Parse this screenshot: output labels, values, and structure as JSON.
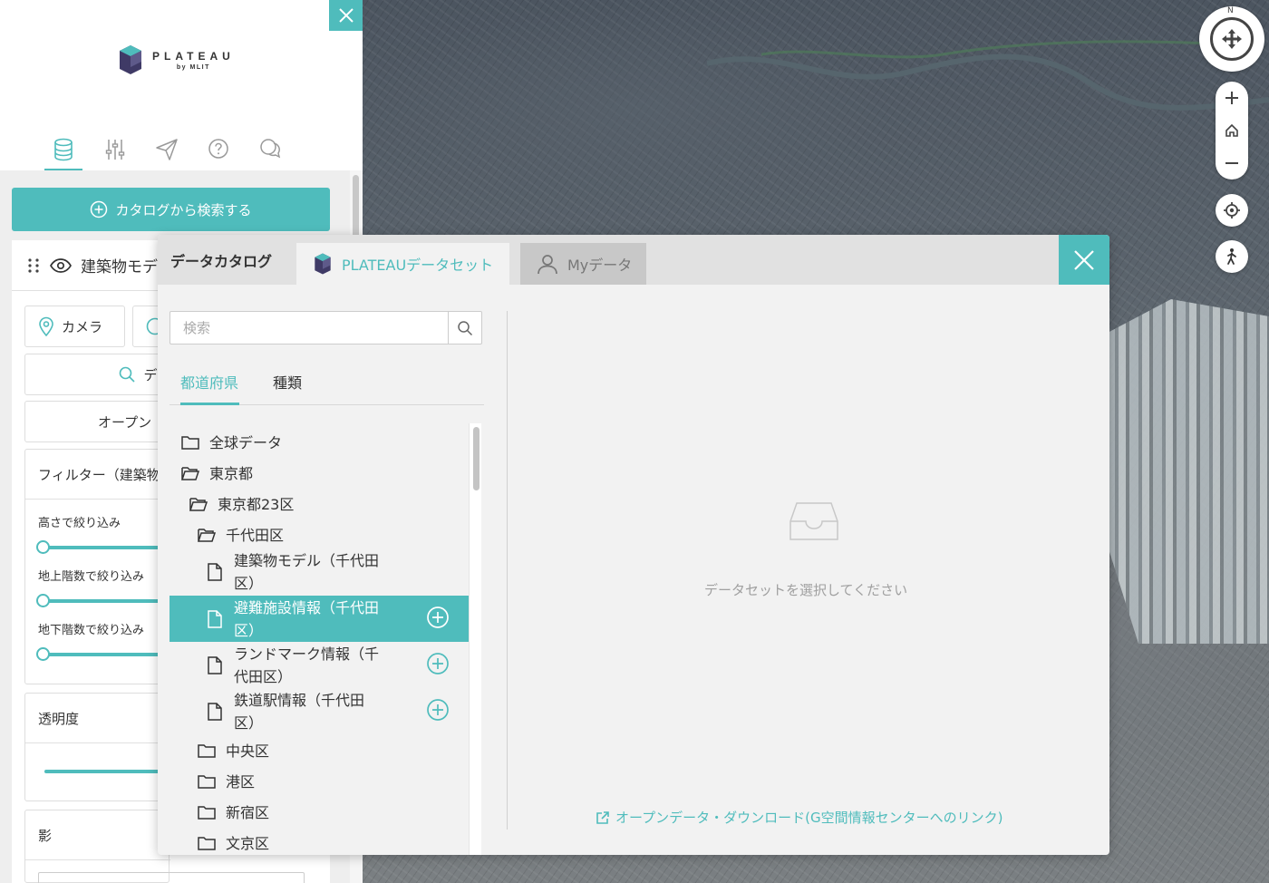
{
  "colors": {
    "accent": "#4fbcbc",
    "panel": "#f2f2f2",
    "text": "#333333"
  },
  "brand": {
    "name": "PLATEAU",
    "sub": "by MLIT"
  },
  "side_tabs": [
    "database-icon",
    "sliders-icon",
    "send-icon",
    "help-icon",
    "chat-icon"
  ],
  "side": {
    "catalog_button": "カタログから検索する",
    "layer_title": "建築物モデ",
    "camera_chip": "カメラ",
    "search_row": "デ",
    "open_row": "オープン",
    "filter_title": "フィルター（建築物",
    "height_filter": "高さで絞り込み",
    "above_floors_filter": "地上階数で絞り込み",
    "below_floors_filter": "地下階数で絞り込み",
    "opacity_label": "透明度",
    "shadow_label": "影"
  },
  "modal": {
    "title": "データカタログ",
    "tab_plateau": "PLATEAUデータセット",
    "tab_mydata": "Myデータ",
    "search_placeholder": "検索",
    "filter_tabs": [
      "都道府県",
      "種類"
    ],
    "tree": [
      {
        "label": "全球データ",
        "type": "folder"
      },
      {
        "label": "東京都",
        "type": "folder-open"
      },
      {
        "label": "東京都23区",
        "type": "folder-open"
      },
      {
        "label": "千代田区",
        "type": "folder-open"
      },
      {
        "label_line1": "建築物モデル（千代田",
        "label_line2": "区）",
        "type": "file"
      },
      {
        "label_line1": "避難施設情報（千代田",
        "label_line2": "区）",
        "type": "file",
        "selected": true
      },
      {
        "label_line1": "ランドマーク情報（千",
        "label_line2": "代田区）",
        "type": "file"
      },
      {
        "label_line1": "鉄道駅情報（千代田",
        "label_line2": "区）",
        "type": "file"
      },
      {
        "label": "中央区",
        "type": "folder"
      },
      {
        "label": "港区",
        "type": "folder"
      },
      {
        "label": "新宿区",
        "type": "folder"
      },
      {
        "label": "文京区",
        "type": "folder"
      }
    ],
    "empty_message": "データセットを選択してください",
    "open_data_link": "オープンデータ・ダウンロード(G空間情報センターへのリンク)"
  },
  "map": {
    "compass_north": "N"
  }
}
